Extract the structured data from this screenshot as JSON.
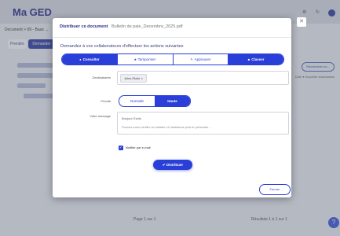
{
  "app": {
    "logo": "Ma GED",
    "breadcrumb": "Document > 09 - Base ...",
    "tabs": [
      "Prendre",
      "Demander"
    ],
    "right_pill": "Rechercher un...",
    "right_text": "Date ▾  Nouvelle autorisation",
    "pager_left": "Page 1 sur 1",
    "pager_right": "Résultats 1 à 1 sur 1"
  },
  "modal": {
    "title": "Distribuer ce document",
    "subtitle": "Bulletin de paie_Decembre_2025.pdf",
    "prompt": "Demandez à vos collaborateurs d'effectuer les actions suivantes",
    "actions": [
      {
        "label": "Consulter",
        "icon": "eye-icon",
        "glyph": "●",
        "active": true
      },
      {
        "label": "Tamponner",
        "icon": "stamp-icon",
        "glyph": "♣",
        "active": false
      },
      {
        "label": "Approuver",
        "icon": "pen-icon",
        "glyph": "✎",
        "active": false
      },
      {
        "label": "Classer",
        "icon": "folder-icon",
        "glyph": "■",
        "active": true
      }
    ],
    "recipients_label": "Destinataires",
    "recipient_chip": "Jules Etoile ×",
    "priority_label": "Priorité",
    "priority_options": {
      "normal": "Normale",
      "high": "Haute"
    },
    "priority_selected": "Haute",
    "message_label": "Votre message",
    "message_line1": "Bonjour Etoile,",
    "message_line2": "Pouvez-vous vérifier ce bulletin et l'ambiance puis le présenter ...",
    "notify_label": "Notifier par e-mail",
    "notify_checked": true,
    "submit_label": "✔ Distribuer",
    "cancel_label": "Fermer"
  },
  "colors": {
    "accent": "#2a3fd8",
    "title": "#2b2f8c"
  }
}
